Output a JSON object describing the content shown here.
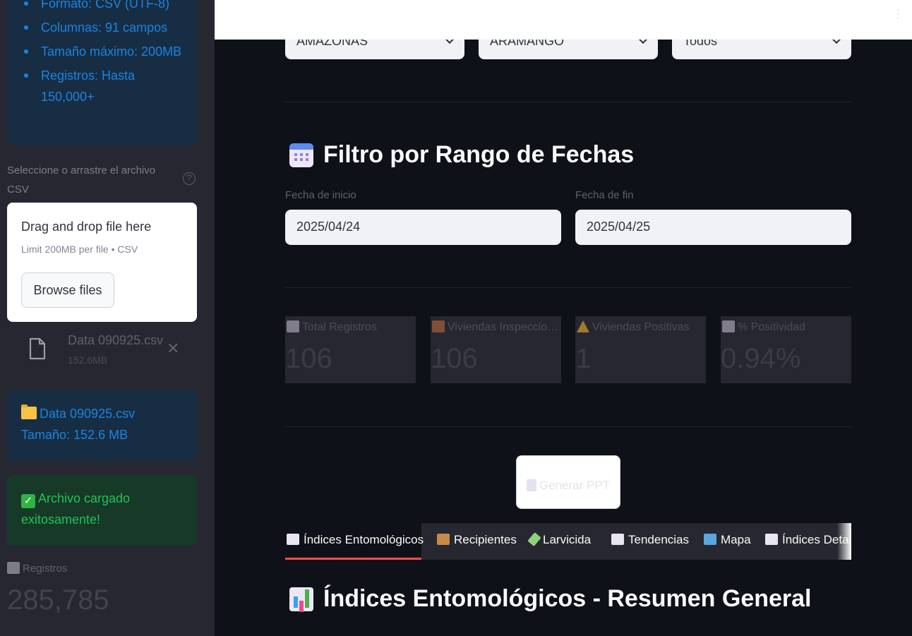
{
  "sidebar": {
    "format_items": [
      "Formato: CSV (UTF-8)",
      "Columnas: 91 campos",
      "Tamaño máximo: 200MB",
      "Registros: Hasta 150,000+"
    ],
    "uploader_label": "Seleccione o arrastre el archivo CSV",
    "help_icon": "?",
    "dropzone_title": "Drag and drop file here",
    "dropzone_limit": "Limit 200MB per file • CSV",
    "browse_label": "Browse files",
    "file_name": "Data 090925.csv",
    "file_size": "152.6MB",
    "close_glyph": "✕",
    "loaded_name": "Data 090925.csv",
    "loaded_size": "Tamaño: 152.6 MB",
    "success_text": "Archivo cargado exitosamente!",
    "registros_label": "Registros",
    "registros_value": "285,785"
  },
  "filters": {
    "departamento": "AMAZONAS",
    "distrito": "ARAMANGO",
    "tipo": "Todos"
  },
  "date_section": {
    "title": "Filtro por Rango de Fechas",
    "start_label": "Fecha de inicio",
    "start_value": "2025/04/24",
    "end_label": "Fecha de fin",
    "end_value": "2025/04/25"
  },
  "metrics": [
    {
      "label": "Total Registros",
      "value": "106",
      "icon": "bar-chart-icon"
    },
    {
      "label": "Viviendas Inspeccionadas",
      "value": "106",
      "icon": "house-icon"
    },
    {
      "label": "Viviendas Positivas",
      "value": "1",
      "icon": "warning-icon"
    },
    {
      "label": "% Positividad",
      "value": "0.94%",
      "icon": "trend-up-icon"
    }
  ],
  "generate_button": "Generar PPT",
  "tabs": [
    {
      "label": "Índices Entomológicos",
      "icon": "bar-chart-icon"
    },
    {
      "label": "Recipientes",
      "icon": "package-icon"
    },
    {
      "label": "Larvicida",
      "icon": "test-tube-icon"
    },
    {
      "label": "Tendencias",
      "icon": "trend-up-icon"
    },
    {
      "label": "Mapa",
      "icon": "map-icon"
    },
    {
      "label": "Índices Detal",
      "icon": "bar-chart-icon"
    }
  ],
  "section_title": "Índices Entomológicos - Resumen General",
  "colors": {
    "accent": "#ff4b4b",
    "background": "#0e1117",
    "sidebar": "#262730",
    "info": "#1c83e1",
    "success": "#21c354"
  }
}
